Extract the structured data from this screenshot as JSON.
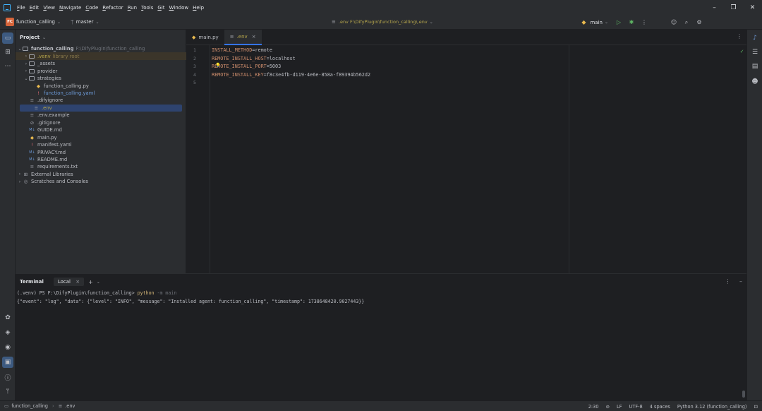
{
  "menu": [
    "File",
    "Edit",
    "View",
    "Navigate",
    "Code",
    "Refactor",
    "Run",
    "Tools",
    "Git",
    "Window",
    "Help"
  ],
  "toolbar": {
    "project_badge": "FC",
    "project_name": "function_calling",
    "branch": "master",
    "file_path": ".env F:\\DifyPlugin\\function_calling\\.env",
    "run_config": "main"
  },
  "project_panel": {
    "title": "Project",
    "items": [
      {
        "label": "function_calling",
        "extra": "F:\\DifyPlugin\\function_calling",
        "type": "folder",
        "depth": 0,
        "arrow": "⌄",
        "bold": true
      },
      {
        "label": ".venv",
        "extra": "library root",
        "type": "folder",
        "depth": 1,
        "arrow": "›",
        "color": "orange",
        "hl": true
      },
      {
        "label": "_assets",
        "type": "folder",
        "depth": 1,
        "arrow": "›"
      },
      {
        "label": "provider",
        "type": "folder",
        "depth": 1,
        "arrow": "›"
      },
      {
        "label": "strategies",
        "type": "folder",
        "depth": 1,
        "arrow": "⌄"
      },
      {
        "label": "function_calling.py",
        "type": "py",
        "depth": 2
      },
      {
        "label": "function_calling.yaml",
        "type": "yaml",
        "depth": 2,
        "color": "blue"
      },
      {
        "label": ".difyignore",
        "type": "txt",
        "depth": 1
      },
      {
        "label": ".env",
        "type": "env",
        "depth": 1,
        "color": "orange",
        "selected": true
      },
      {
        "label": ".env.example",
        "type": "txt",
        "depth": 1
      },
      {
        "label": ".gitignore",
        "type": "ignore",
        "depth": 1
      },
      {
        "label": "GUIDE.md",
        "type": "md",
        "depth": 1
      },
      {
        "label": "main.py",
        "type": "py",
        "depth": 1
      },
      {
        "label": "manifest.yaml",
        "type": "yaml",
        "depth": 1
      },
      {
        "label": "PRIVACY.md",
        "type": "md",
        "depth": 1
      },
      {
        "label": "README.md",
        "type": "md",
        "depth": 1
      },
      {
        "label": "requirements.txt",
        "type": "txt",
        "depth": 1
      },
      {
        "label": "External Libraries",
        "type": "lib",
        "depth": 0,
        "arrow": "›"
      },
      {
        "label": "Scratches and Consoles",
        "type": "scratch",
        "depth": 0,
        "arrow": "›"
      }
    ]
  },
  "editor": {
    "tabs": [
      {
        "label": "main.py",
        "active": false
      },
      {
        "label": ".env",
        "active": true
      }
    ],
    "lines": [
      {
        "num": "1",
        "key": "INSTALL_METHOD",
        "value": "remote"
      },
      {
        "num": "2",
        "key": "REMOTE_INSTALL_HOST",
        "value": "localhost"
      },
      {
        "num": "3",
        "key": "REMOTE_INSTALL_PORT",
        "value": "5003"
      },
      {
        "num": "4",
        "key": "REMOTE_INSTALL_KEY",
        "value": "f8c3e4fb-d119-4e6e-858a-f89394b562d2"
      },
      {
        "num": "5",
        "key": "",
        "value": ""
      }
    ]
  },
  "terminal": {
    "title": "Terminal",
    "tab": "Local",
    "prompt": "(.venv) PS F:\\DifyPlugin\\function_calling> ",
    "command": "python",
    "args": " -m main",
    "output": "{\"event\": \"log\", \"data\": {\"level\": \"INFO\", \"message\": \"Installed agent: function_calling\", \"timestamp\": 1738648420.9027443}}"
  },
  "statusbar": {
    "breadcrumb_project": "function_calling",
    "breadcrumb_file": ".env",
    "position": "2:30",
    "line_ending": "LF",
    "encoding": "UTF-8",
    "indent": "4 spaces",
    "interpreter": "Python 3.12 (function_calling)"
  }
}
